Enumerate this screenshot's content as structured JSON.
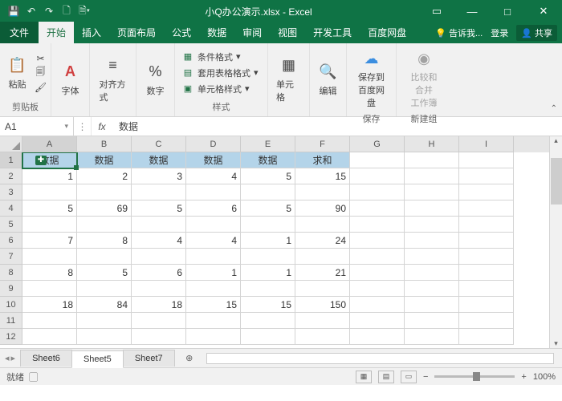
{
  "title": "小Q办公演示.xlsx - Excel",
  "qat": {
    "save": "save-icon",
    "undo": "undo-icon",
    "redo": "redo-icon",
    "new": "new-doc-icon",
    "preview": "print-preview-icon"
  },
  "winbtns": {
    "ribmin": "▭",
    "min": "—",
    "max": "□",
    "close": "✕"
  },
  "tabs": {
    "file": "文件",
    "items": [
      "开始",
      "插入",
      "页面布局",
      "公式",
      "数据",
      "审阅",
      "视图",
      "开发工具",
      "百度网盘"
    ],
    "active": 0,
    "tell": "告诉我...",
    "login": "登录",
    "share": "共享"
  },
  "ribbon": {
    "clipboard": {
      "label": "剪贴板",
      "paste": "粘贴",
      "cut": "cut-icon",
      "copy": "copy-icon",
      "brush": "format-painter-icon"
    },
    "font": {
      "label": "字体"
    },
    "align": {
      "label": "对齐方式"
    },
    "number": {
      "label": "数字"
    },
    "styles": {
      "label": "样式",
      "cond": "条件格式",
      "table": "套用表格格式",
      "cell": "单元格样式"
    },
    "cells": {
      "label": "单元格"
    },
    "editing": {
      "label": "编辑"
    },
    "bdpan": {
      "label": "保存",
      "btn": "保存到\n百度网盘"
    },
    "newg": {
      "label": "新建组",
      "btn": "比较和合并\n工作簿"
    }
  },
  "cellref": "A1",
  "formula": "数据",
  "cols": [
    "A",
    "B",
    "C",
    "D",
    "E",
    "F",
    "G",
    "H",
    "I"
  ],
  "activeCol": 0,
  "activeRow": 0,
  "grid": [
    [
      "数据",
      "数据",
      "数据",
      "数据",
      "数据",
      "求和",
      "",
      "",
      ""
    ],
    [
      "1",
      "2",
      "3",
      "4",
      "5",
      "15",
      "",
      "",
      ""
    ],
    [
      "",
      "",
      "",
      "",
      "",
      "",
      "",
      "",
      ""
    ],
    [
      "5",
      "69",
      "5",
      "6",
      "5",
      "90",
      "",
      "",
      ""
    ],
    [
      "",
      "",
      "",
      "",
      "",
      "",
      "",
      "",
      ""
    ],
    [
      "7",
      "8",
      "4",
      "4",
      "1",
      "24",
      "",
      "",
      ""
    ],
    [
      "",
      "",
      "",
      "",
      "",
      "",
      "",
      "",
      ""
    ],
    [
      "8",
      "5",
      "6",
      "1",
      "1",
      "21",
      "",
      "",
      ""
    ],
    [
      "",
      "",
      "",
      "",
      "",
      "",
      "",
      "",
      ""
    ],
    [
      "18",
      "84",
      "18",
      "15",
      "15",
      "150",
      "",
      "",
      ""
    ],
    [
      "",
      "",
      "",
      "",
      "",
      "",
      "",
      "",
      ""
    ],
    [
      "",
      "",
      "",
      "",
      "",
      "",
      "",
      "",
      ""
    ]
  ],
  "sheets": {
    "items": [
      "Sheet6",
      "Sheet5",
      "Sheet7"
    ],
    "active": 1
  },
  "status": {
    "ready": "就绪",
    "zoom": "100%"
  }
}
